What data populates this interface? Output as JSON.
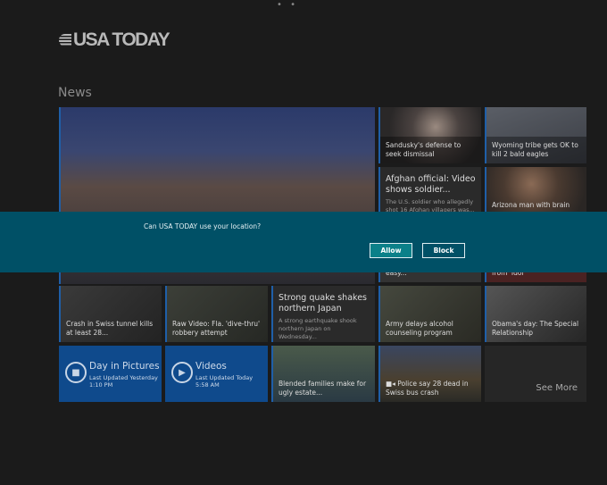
{
  "app": {
    "logo": "USA TODAY",
    "section": "News"
  },
  "tiles": {
    "t1": "Sandusky's defense to seek dismissal",
    "t2": "Wyoming tribe gets OK to kill 2 bald eagles",
    "t3": {
      "title": "Afghan official: Video shows soldier...",
      "sub": "The U.S. soldier who allegedly shot 16 Afghan villagers was..."
    },
    "t4": "Arizona man with brain cancer",
    "t5": "easy...",
    "t6": "from 'Idol'",
    "t7": "Crash in Swiss tunnel kills at least 28...",
    "t8": "Raw Video: Fla. 'dive-thru' robbery attempt",
    "t9": {
      "title": "Strong quake shakes northern Japan",
      "sub": "A strong earthquake shook northern Japan on Wednesday..."
    },
    "t10": "Army delays alcohol counseling program",
    "t11": "Obama's day: The Special Relationship",
    "pictures": {
      "title": "Day in Pictures",
      "updated": "Last Updated Yesterday",
      "time": "1:10 PM"
    },
    "videos": {
      "title": "Videos",
      "updated": "Last Updated Today",
      "time": "5:58 AM"
    },
    "t12": "Blended families make for ugly estate...",
    "t13": "Police say 28 dead in Swiss bus crash",
    "see_more": "See More"
  },
  "dialog": {
    "question": "Can USA TODAY use your location?",
    "allow": "Allow",
    "block": "Block"
  }
}
